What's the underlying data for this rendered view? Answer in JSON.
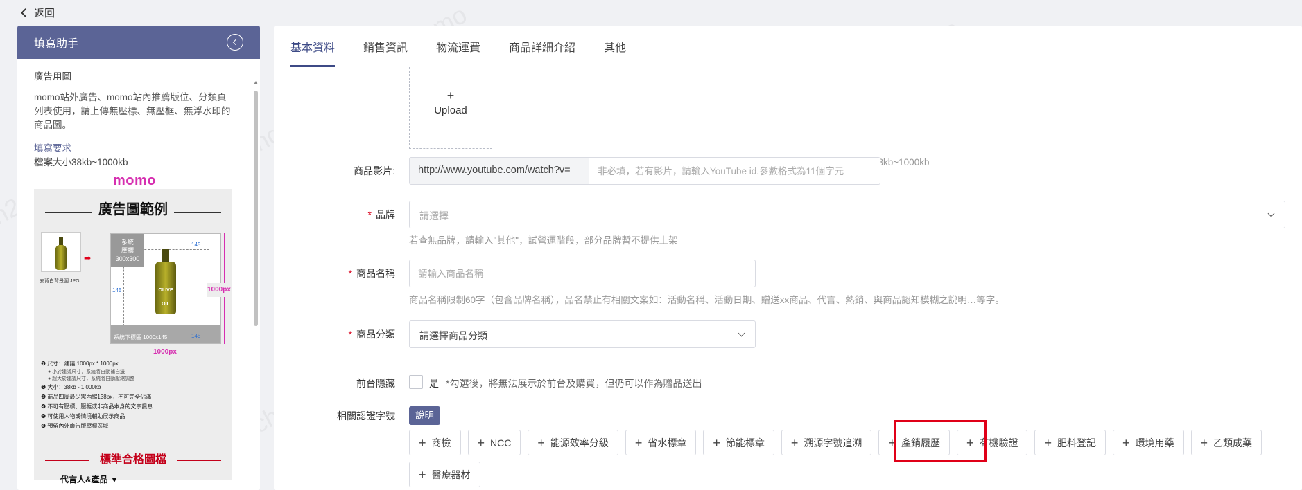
{
  "topbar": {
    "back_label": "返回"
  },
  "helper": {
    "title": "填寫助手",
    "section_title": "廣告用圖",
    "section_desc": "momo站外廣告、momo站內推薦版位、分類頁列表使用，請上傳無壓標、無壓框、無浮水印的商品圖。",
    "req_link": "填寫要求",
    "req_text": "檔案大小38kb~1000kb",
    "logo_text": "momo",
    "example": {
      "title": "廣告圖範例",
      "thumb_caption": "去背白背景圖.JPG",
      "badge_top": "系統\n壓標\n300x300",
      "badge_bottom": "系統下標區 1000x145",
      "bottle_label": "OLIVE OIL",
      "v_size": "1000px",
      "h_size": "1000px",
      "n145": "145",
      "rules": [
        "❶ 尺寸：建議 1000px * 1000px",
        "● 小於建議尺寸，系統將自動補白邊",
        "● 超大於建議尺寸，系統將自動壓縮調整",
        "❷ 大小：38kb - 1,000kb",
        "❸ 商品四周最少需內縮138px，不可完全佔滿",
        "❹ 不可有壓標、壓框或非商品本身的文字訊息",
        "❺ 可使用人物或情境輔助展示商品",
        "❻ 預留內外廣告版壓標區域"
      ],
      "std_title": "標準合格圖檔",
      "spokes": "代言人&產品 ▼"
    }
  },
  "tabs": [
    "基本資料",
    "銷售資訊",
    "物流運費",
    "商品詳細介紹",
    "其他"
  ],
  "upload": {
    "plus": "+",
    "label": "Upload"
  },
  "upload_hint": "momo站外廣告、momo站內推薦版位、分類頁列表使用，請上傳無壓標、無壓框、無浮水印的商品圖，檔案大小38kb~1000kb",
  "video": {
    "label": "商品影片:",
    "prefix": "http://www.youtube.com/watch?v=",
    "placeholder": "非必填，若有影片，請輸入YouTube id.參數格式為11個字元"
  },
  "brand": {
    "label": "品牌",
    "placeholder": "請選擇",
    "hint": "若查無品牌，請輸入\"其他\"，試營運階段，部分品牌暫不提供上架"
  },
  "product_name": {
    "label": "商品名稱",
    "placeholder": "請輸入商品名稱",
    "hint": "商品名稱限制60字（包含品牌名稱），品名禁止有相關文案如：活動名稱、活動日期、贈送xx商品、代言、熱銷、與商品認知模糊之說明…等字。"
  },
  "category": {
    "label": "商品分類",
    "value": "請選擇商品分類"
  },
  "hidden": {
    "label": "前台隱藏",
    "option": "是",
    "note": "*勾選後，將無法展示於前台及購買，但仍可以作為贈品送出"
  },
  "certs": {
    "label": "相關認證字號",
    "explain": "說明",
    "items": [
      "商檢",
      "NCC",
      "能源效率分級",
      "省水標章",
      "節能標章",
      "溯源字號追溯",
      "產銷履歷",
      "有機驗證",
      "肥料登記",
      "環境用藥",
      "乙類成藥",
      "醫療器材"
    ]
  },
  "required_mark": "*",
  "watermark_text": "sh2chang momo",
  "colors": {
    "accent": "#5b6496",
    "tab_active": "#3d4a86",
    "required": "#d9001b",
    "highlight": "#e00018",
    "brand_pink": "#d62fb0"
  }
}
